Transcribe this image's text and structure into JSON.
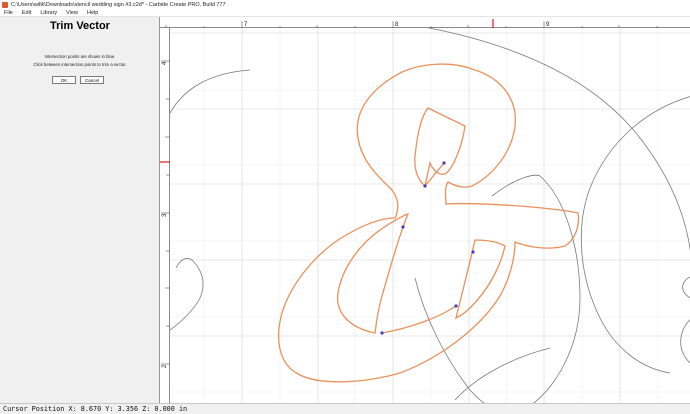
{
  "window": {
    "title": "C:\\Users\\willk\\Downloads\\stencil wedding sign #3.c2d* - Carbide Create PRO, Build 777"
  },
  "menu": [
    "File",
    "Edit",
    "Library",
    "View",
    "Help"
  ],
  "panel": {
    "title": "Trim Vector",
    "info_line1": "Intersection points are shown in blue.",
    "info_line2": "Click between intersection points to trim a vector.",
    "ok_label": "OK",
    "cancel_label": "Cancel"
  },
  "rulers": {
    "top_labels": [
      "7",
      "8",
      "9"
    ],
    "left_labels": [
      "4",
      "3",
      "2"
    ]
  },
  "colors": {
    "vector_selected": "#e9915b",
    "vector_other": "#7a7a7a",
    "intersection_point": "#4a3ab8",
    "ruler_marker": "#e01818",
    "grid_major": "#d4d4d4",
    "grid_minor": "#ececec"
  },
  "status": {
    "text": "Cursor Position X: 8.670 Y: 3.356 Z: 0.000 in"
  }
}
